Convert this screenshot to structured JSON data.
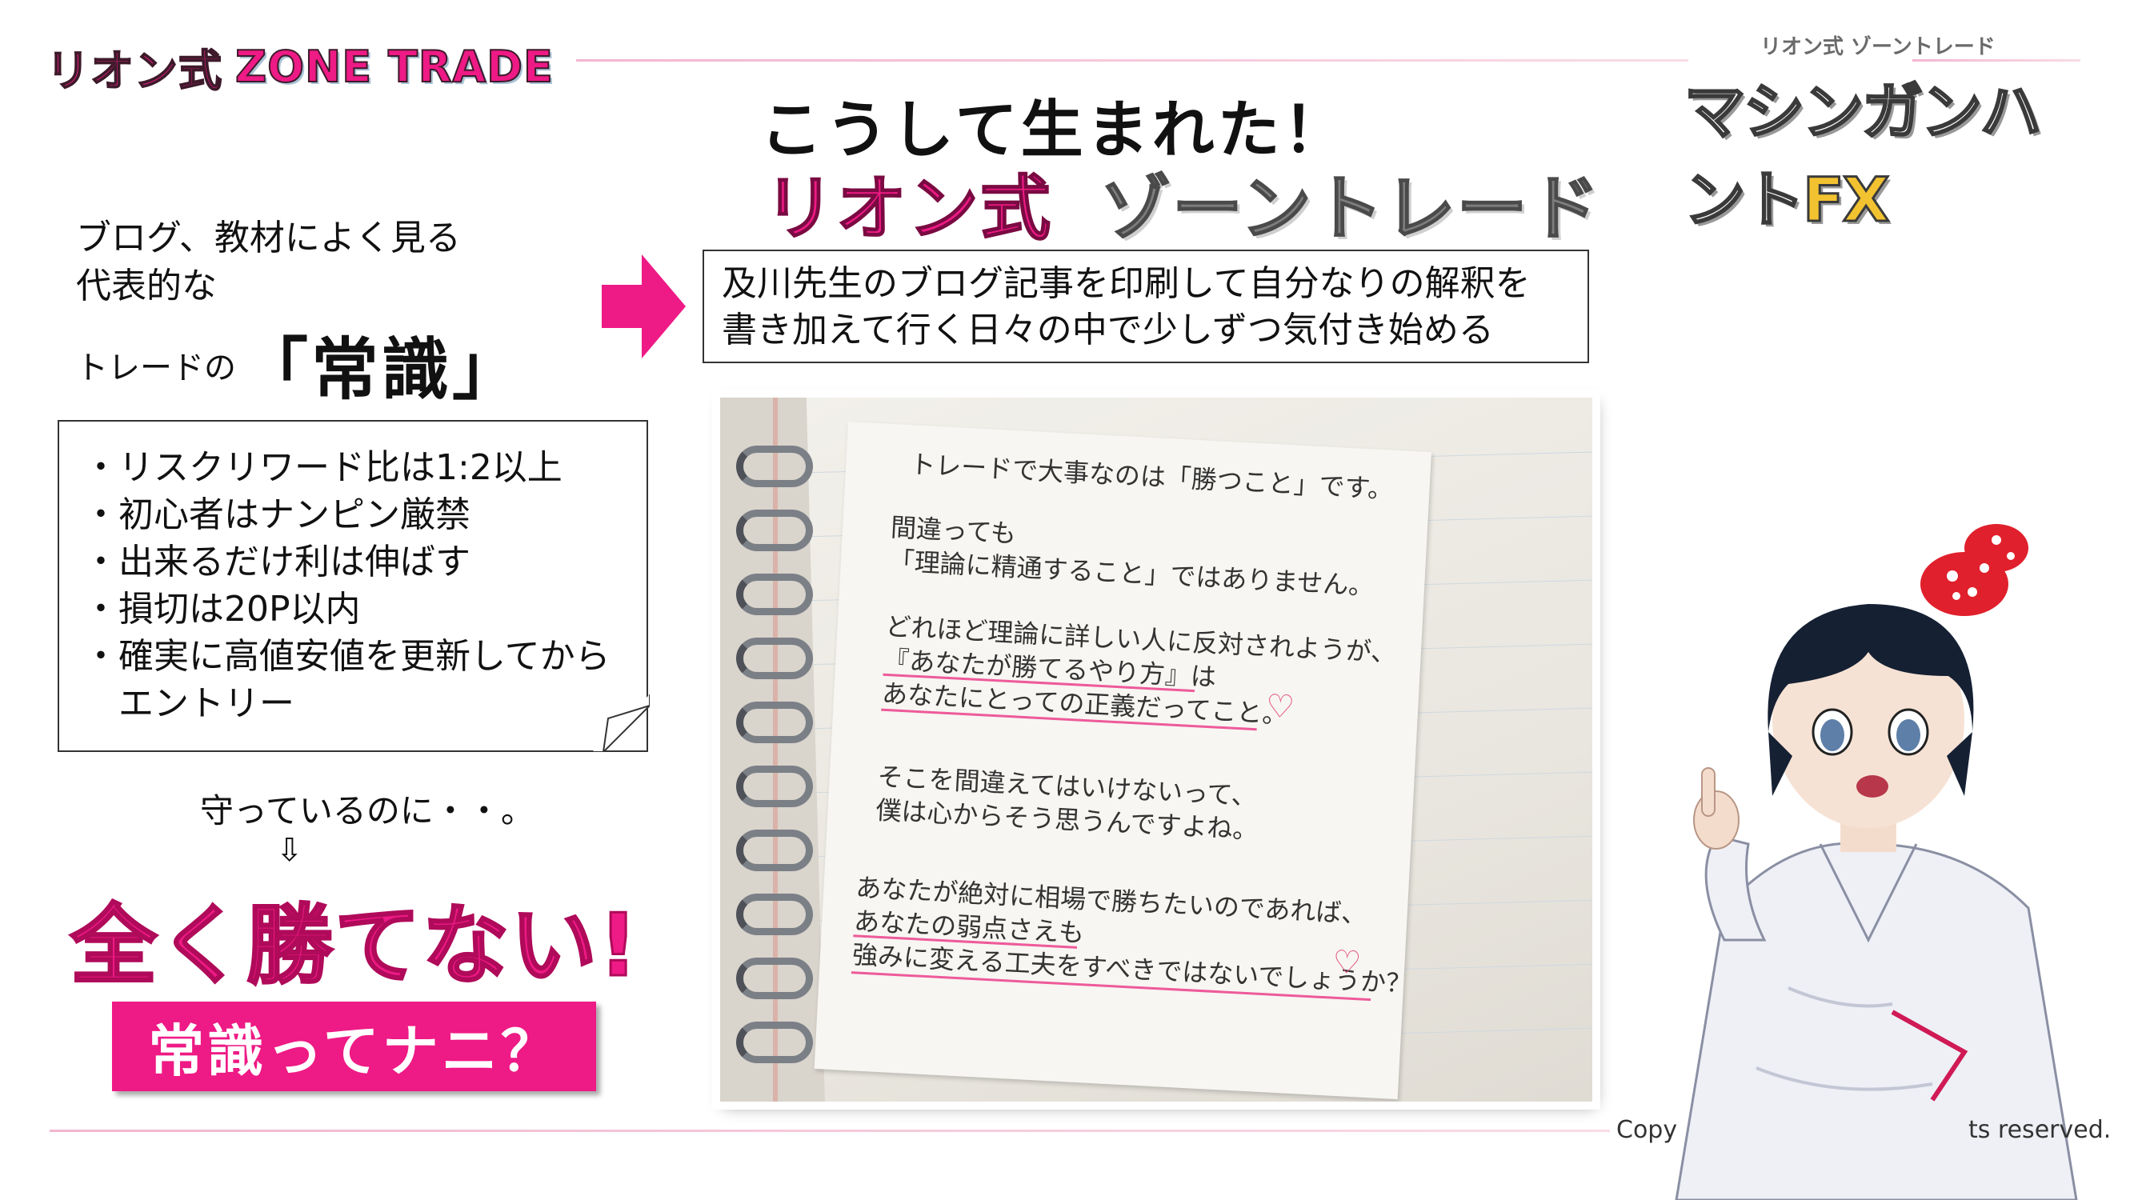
{
  "header": {
    "logo_left_jp": "リオン式",
    "logo_left_en": "ZONE TRADE",
    "logo_right_small": "リオン式 ゾーントレード",
    "logo_right_big": "マシンガンハント",
    "logo_right_fx": "FX"
  },
  "title": {
    "line1": "こうして生まれた！",
    "line2_pink": "リオン式",
    "line2_gray": "ゾーントレード"
  },
  "left": {
    "blog_line1": "ブログ、教材によく見る",
    "blog_line2": "代表的な",
    "trade_prefix": "トレードの",
    "common_sense": "「常識」",
    "rules": [
      "・リスクリワード比は1:2以上",
      "・初心者はナンピン厳禁",
      "・出来るだけ利は伸ばす",
      "・損切は20P以内",
      "・確実に高値安値を更新してから",
      "　エントリー"
    ],
    "protect_text": "守っているのに・・。",
    "down_arrow": "⇩",
    "cant_win": "全く勝てない!",
    "common_button": "常識ってナニ？"
  },
  "description": {
    "line1": "及川先生のブログ記事を印刷して自分なりの解釈を",
    "line2": "書き加えて行く日々の中で少しずつ気付き始める"
  },
  "note": {
    "lines": [
      "トレードで大事なのは「勝つこと」です。",
      "間違っても",
      "「理論に精通すること」ではありません。",
      "どれほど理論に詳しい人に反対されようが、",
      "『あなたが勝てるやり方』は",
      "あなたにとっての正義だってこと。",
      "そこを間違えてはいけないって、",
      "僕は心からそう思うんですよね。",
      "あなたが絶対に相場で勝ちたいのであれば、",
      "あなたの弱点さえも",
      "強みに変える工夫をすべきではないでしょうか？"
    ]
  },
  "footer": {
    "copyright_left": "Copy",
    "copyright_right": "ts reserved."
  },
  "colors": {
    "accent_pink": "#ee1a85",
    "gray": "#7d7d7d"
  }
}
